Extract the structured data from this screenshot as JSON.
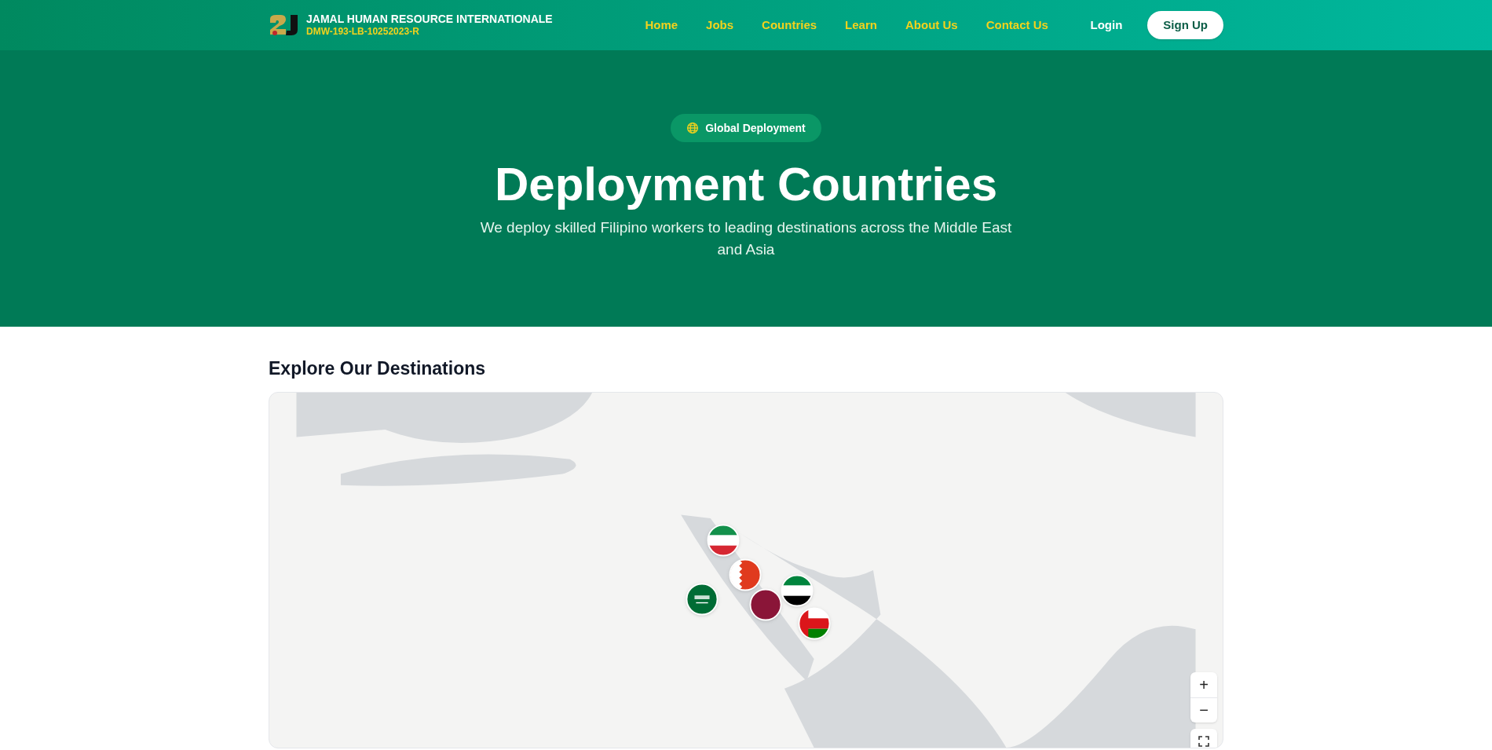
{
  "header": {
    "brand": "JAMAL HUMAN RESOURCE INTERNATIONALE",
    "license": "DMW-193-LB-10252023-R",
    "nav": [
      {
        "label": "Home"
      },
      {
        "label": "Jobs"
      },
      {
        "label": "Countries"
      },
      {
        "label": "Learn"
      },
      {
        "label": "About Us"
      },
      {
        "label": "Contact Us"
      }
    ],
    "login": "Login",
    "signup": "Sign Up"
  },
  "hero": {
    "badge": "Global Deployment",
    "title": "Deployment Countries",
    "subtitle": "We deploy skilled Filipino workers to leading destinations across the Middle East and Asia"
  },
  "section": {
    "title": "Explore Our Destinations",
    "markers": [
      {
        "kind": "qatar"
      },
      {
        "kind": "bahrain"
      },
      {
        "kind": "kuwait"
      },
      {
        "kind": "saudi"
      },
      {
        "kind": "uae"
      },
      {
        "kind": "oman"
      }
    ],
    "controls": [
      {
        "label": "+"
      },
      {
        "label": "−"
      }
    ]
  }
}
